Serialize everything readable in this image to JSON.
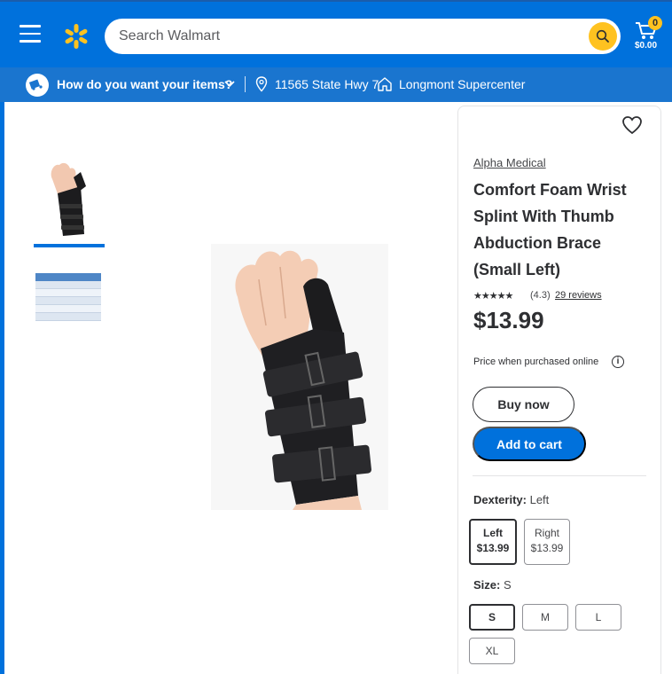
{
  "header": {
    "search_placeholder": "Search Walmart",
    "cart_count": "0",
    "cart_total": "$0.00"
  },
  "delivery": {
    "question": "How do you want your items?",
    "address": "11565 State Hwy 7",
    "store": "Longmont Supercenter"
  },
  "product": {
    "brand": "Alpha Medical",
    "title": "Comfort Foam Wrist Splint With Thumb Abduction Brace (Small Left)",
    "stars": "★★★★★",
    "rating": "(4.3)",
    "reviews": "29 reviews",
    "price": "$13.99",
    "price_note": "Price when purchased online",
    "buy_now_label": "Buy now",
    "add_to_cart_label": "Add to cart"
  },
  "dexterity": {
    "label": "Dexterity:",
    "value": "Left",
    "options": [
      {
        "name": "Left",
        "price": "$13.99"
      },
      {
        "name": "Right",
        "price": "$13.99"
      }
    ]
  },
  "size": {
    "label": "Size:",
    "value": "S",
    "options": [
      "S",
      "M",
      "L",
      "XL"
    ]
  },
  "colors": {
    "brand_blue": "#0071dc",
    "spark_yellow": "#ffc220"
  }
}
